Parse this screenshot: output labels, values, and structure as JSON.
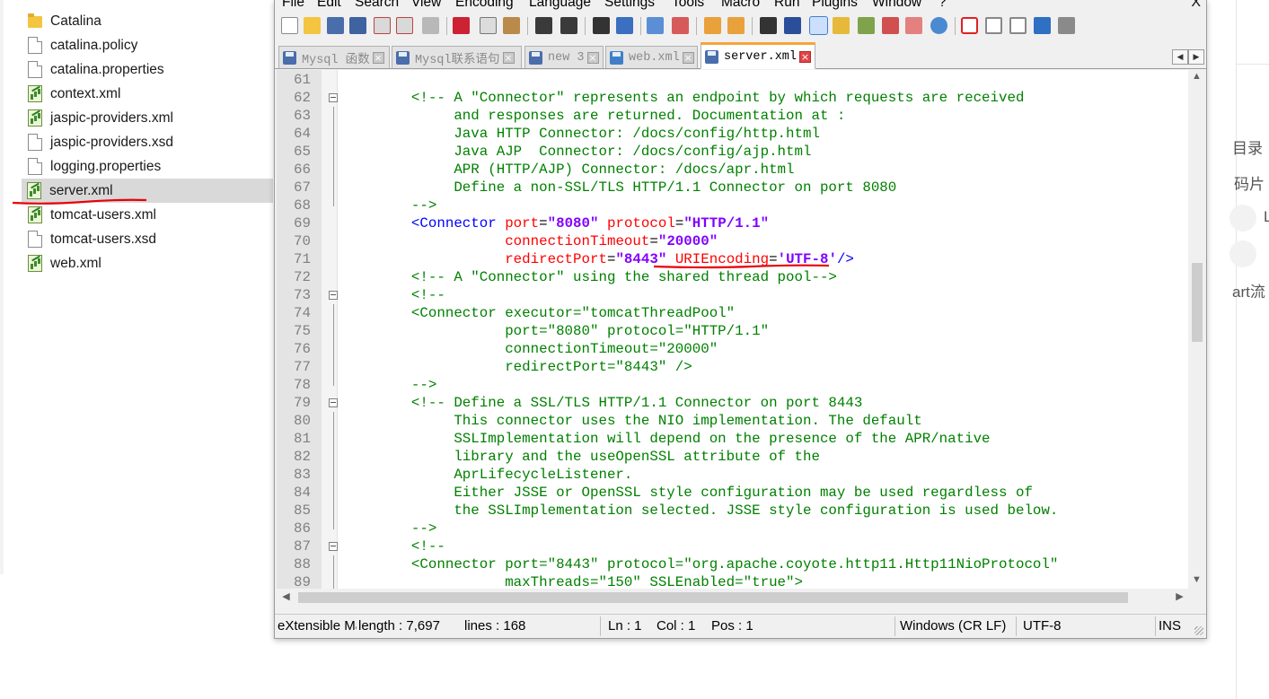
{
  "explorer": {
    "files": [
      {
        "name": "Catalina",
        "icon": "folder-icon"
      },
      {
        "name": "catalina.policy",
        "icon": "document-icon"
      },
      {
        "name": "catalina.properties",
        "icon": "document-icon"
      },
      {
        "name": "context.xml",
        "icon": "xml-file-icon"
      },
      {
        "name": "jaspic-providers.xml",
        "icon": "xml-file-icon"
      },
      {
        "name": "jaspic-providers.xsd",
        "icon": "document-icon"
      },
      {
        "name": "logging.properties",
        "icon": "document-icon"
      },
      {
        "name": "server.xml",
        "icon": "xml-file-icon",
        "selected": true
      },
      {
        "name": "tomcat-users.xml",
        "icon": "xml-file-icon"
      },
      {
        "name": "tomcat-users.xsd",
        "icon": "document-icon"
      },
      {
        "name": "web.xml",
        "icon": "xml-file-icon"
      }
    ]
  },
  "menu": [
    "File",
    "Edit",
    "Search",
    "View",
    "Encoding",
    "Language",
    "Settings",
    "Tools",
    "Macro",
    "Run",
    "Plugins",
    "Window",
    "?"
  ],
  "menu_close": "X",
  "tabs": [
    {
      "label": "Mysql 函数",
      "active": false
    },
    {
      "label": "Mysql联系语句",
      "active": false
    },
    {
      "label": "new 3",
      "active": false
    },
    {
      "label": "web.xml",
      "active": false
    },
    {
      "label": "server.xml",
      "active": true
    }
  ],
  "tab_close_glyph": "×",
  "tabnav": {
    "left": "◀",
    "right": "▶"
  },
  "editor": {
    "lines": [
      {
        "n": "61",
        "tokens": []
      },
      {
        "n": "62",
        "fold": "open",
        "tokens": [
          [
            "c",
            "    <!-- A \"Connector\" represents an endpoint by which requests are received"
          ]
        ]
      },
      {
        "n": "63",
        "tokens": [
          [
            "c",
            "         and responses are returned. Documentation at :"
          ]
        ]
      },
      {
        "n": "64",
        "tokens": [
          [
            "c",
            "         Java HTTP Connector: /docs/config/http.html"
          ]
        ]
      },
      {
        "n": "65",
        "tokens": [
          [
            "c",
            "         Java AJP  Connector: /docs/config/ajp.html"
          ]
        ]
      },
      {
        "n": "66",
        "tokens": [
          [
            "c",
            "         APR (HTTP/AJP) Connector: /docs/apr.html"
          ]
        ]
      },
      {
        "n": "67",
        "tokens": [
          [
            "c",
            "         Define a non-SSL/TLS HTTP/1.1 Connector on port 8080"
          ]
        ]
      },
      {
        "n": "68",
        "fold": "end",
        "tokens": [
          [
            "c",
            "    -->"
          ]
        ]
      },
      {
        "n": "69",
        "tokens": [
          [
            "p",
            "    "
          ],
          [
            "t",
            "<Connector"
          ],
          [
            "p",
            " "
          ],
          [
            "a",
            "port"
          ],
          [
            "p",
            "="
          ],
          [
            "v",
            "\"8080\""
          ],
          [
            "p",
            " "
          ],
          [
            "a",
            "protocol"
          ],
          [
            "p",
            "="
          ],
          [
            "v",
            "\"HTTP/1.1\""
          ]
        ]
      },
      {
        "n": "70",
        "tokens": [
          [
            "p",
            "               "
          ],
          [
            "a",
            "connectionTimeout"
          ],
          [
            "p",
            "="
          ],
          [
            "v",
            "\"20000\""
          ]
        ]
      },
      {
        "n": "71",
        "tokens": [
          [
            "p",
            "               "
          ],
          [
            "a",
            "redirectPort"
          ],
          [
            "p",
            "="
          ],
          [
            "v",
            "\"8443\""
          ],
          [
            "p",
            " "
          ],
          [
            "a",
            "URIEncoding"
          ],
          [
            "p",
            "="
          ],
          [
            "v",
            "'UTF-8'"
          ],
          [
            "t",
            "/>"
          ]
        ]
      },
      {
        "n": "72",
        "tokens": [
          [
            "c",
            "    <!-- A \"Connector\" using the shared thread pool-->"
          ]
        ]
      },
      {
        "n": "73",
        "fold": "open",
        "tokens": [
          [
            "c",
            "    <!--"
          ]
        ]
      },
      {
        "n": "74",
        "tokens": [
          [
            "c",
            "    <Connector executor=\"tomcatThreadPool\""
          ]
        ]
      },
      {
        "n": "75",
        "tokens": [
          [
            "c",
            "               port=\"8080\" protocol=\"HTTP/1.1\""
          ]
        ]
      },
      {
        "n": "76",
        "tokens": [
          [
            "c",
            "               connectionTimeout=\"20000\""
          ]
        ]
      },
      {
        "n": "77",
        "tokens": [
          [
            "c",
            "               redirectPort=\"8443\" />"
          ]
        ]
      },
      {
        "n": "78",
        "fold": "end",
        "tokens": [
          [
            "c",
            "    -->"
          ]
        ]
      },
      {
        "n": "79",
        "fold": "open",
        "tokens": [
          [
            "c",
            "    <!-- Define a SSL/TLS HTTP/1.1 Connector on port 8443"
          ]
        ]
      },
      {
        "n": "80",
        "tokens": [
          [
            "c",
            "         This connector uses the NIO implementation. The default"
          ]
        ]
      },
      {
        "n": "81",
        "tokens": [
          [
            "c",
            "         SSLImplementation will depend on the presence of the APR/native"
          ]
        ]
      },
      {
        "n": "82",
        "tokens": [
          [
            "c",
            "         library and the useOpenSSL attribute of the"
          ]
        ]
      },
      {
        "n": "83",
        "tokens": [
          [
            "c",
            "         AprLifecycleListener."
          ]
        ]
      },
      {
        "n": "84",
        "tokens": [
          [
            "c",
            "         Either JSSE or OpenSSL style configuration may be used regardless of"
          ]
        ]
      },
      {
        "n": "85",
        "tokens": [
          [
            "c",
            "         the SSLImplementation selected. JSSE style configuration is used below."
          ]
        ]
      },
      {
        "n": "86",
        "fold": "end",
        "tokens": [
          [
            "c",
            "    -->"
          ]
        ]
      },
      {
        "n": "87",
        "fold": "open",
        "tokens": [
          [
            "c",
            "    <!--"
          ]
        ]
      },
      {
        "n": "88",
        "tokens": [
          [
            "c",
            "    <Connector port=\"8443\" protocol=\"org.apache.coyote.http11.Http11NioProtocol\""
          ]
        ]
      },
      {
        "n": "89",
        "tokens": [
          [
            "c",
            "               maxThreads=\"150\" SSLEnabled=\"true\">"
          ]
        ]
      }
    ]
  },
  "scroll_glyphs": {
    "up": "▲",
    "down": "▼",
    "left": "◀",
    "right": "▶"
  },
  "status": {
    "lang": "eXtensible Markup Language file",
    "length": "length : 7,697",
    "lines": "lines : 168",
    "ln": "Ln : 1",
    "col": "Col : 1",
    "pos": "Pos : 1",
    "eol": "Windows (CR LF)",
    "encoding": "UTF-8",
    "mode": "INS"
  },
  "background_page": {
    "snippets": [
      "目录",
      "码片",
      "L",
      "art流"
    ]
  },
  "colors": {
    "comment": "#008000",
    "tag": "#0000ff",
    "attribute": "#ff0000",
    "value": "#8000ff",
    "annotation": "#e8000b",
    "active_tab_accent": "#f7a43b"
  }
}
